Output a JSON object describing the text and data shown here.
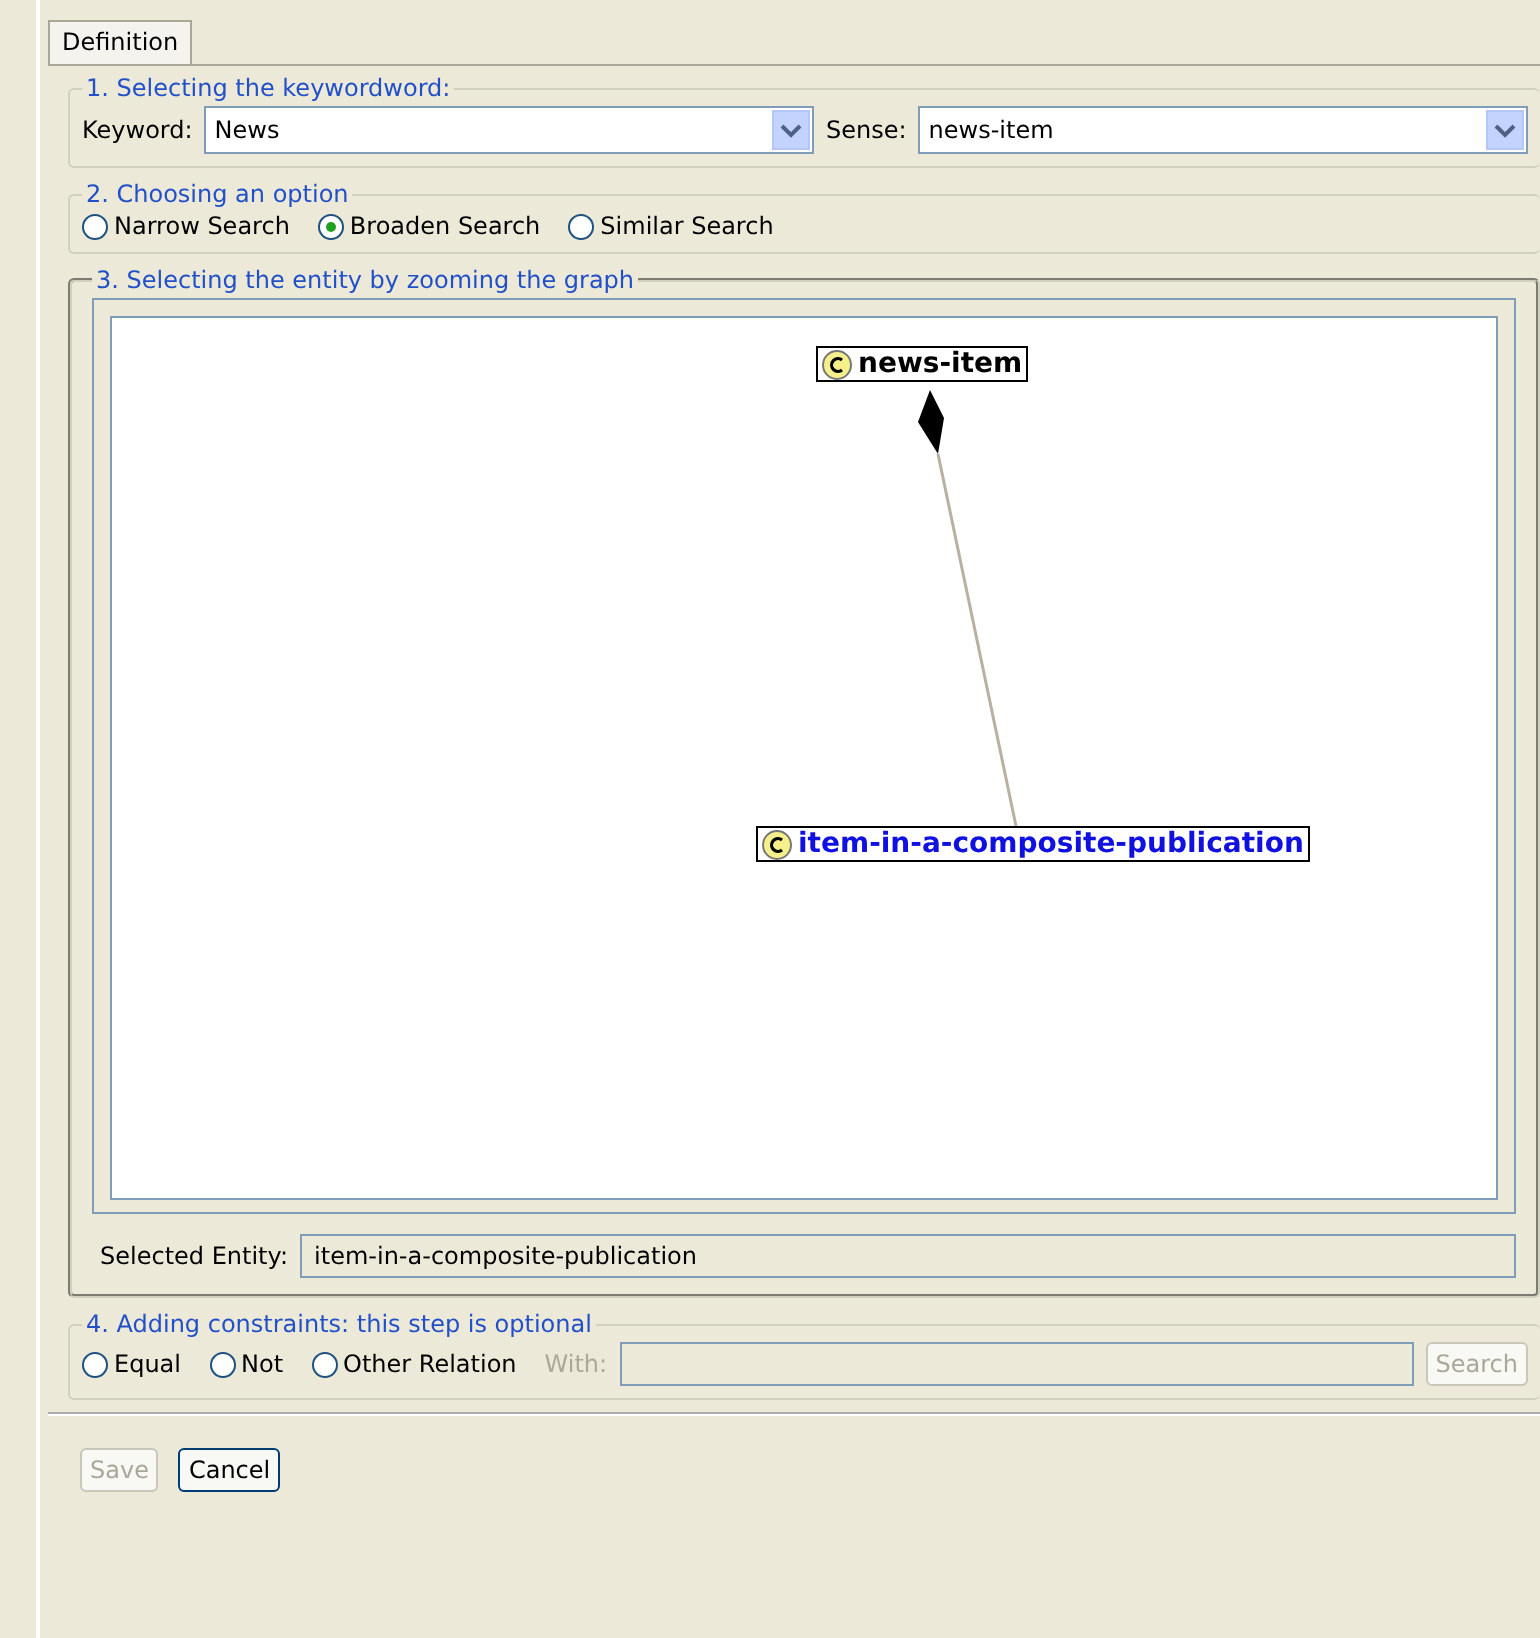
{
  "tabs": [
    {
      "label": "Definition",
      "selected": true
    }
  ],
  "step1": {
    "title": "1. Selecting the keywordword:",
    "keyword_label": "Keyword:",
    "keyword_value": "News",
    "sense_label": "Sense:",
    "sense_value": "news-item"
  },
  "step2": {
    "title": "2. Choosing an option",
    "options": [
      {
        "label": "Narrow Search",
        "selected": false
      },
      {
        "label": "Broaden Search",
        "selected": true
      },
      {
        "label": "Similar Search",
        "selected": false
      }
    ]
  },
  "step3": {
    "title": "3. Selecting the entity by zooming the graph",
    "nodes": [
      {
        "label": "news-item",
        "selected": false
      },
      {
        "label": "item-in-a-composite-publication",
        "selected": true
      }
    ],
    "selected_label": "Selected Entity:",
    "selected_value": "item-in-a-composite-publication"
  },
  "step4": {
    "title": "4. Adding constraints: this step is optional",
    "options": [
      {
        "label": "Equal",
        "selected": false
      },
      {
        "label": "Not",
        "selected": false
      },
      {
        "label": "Other Relation",
        "selected": false
      }
    ],
    "with_label": "With:",
    "search_button": {
      "label": "Search",
      "disabled": true
    }
  },
  "buttons": [
    {
      "label": "Save",
      "disabled": true
    },
    {
      "label": "Cancel",
      "disabled": false
    }
  ]
}
